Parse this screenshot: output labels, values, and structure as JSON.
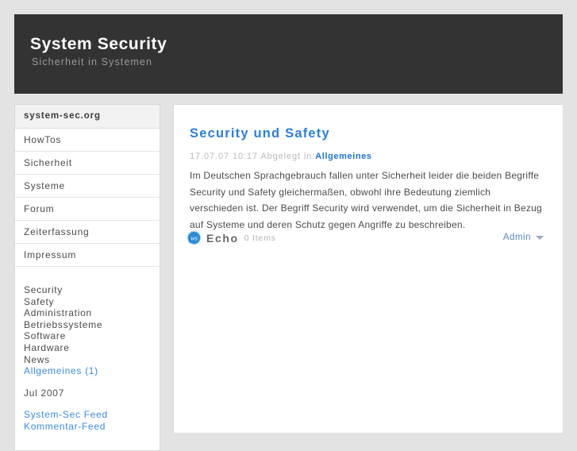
{
  "site": {
    "title": "System Security",
    "tagline": "Sicherheit in Systemen"
  },
  "sidebar": {
    "nav_header": "system-sec.org",
    "nav_items": [
      {
        "label": "HowTos"
      },
      {
        "label": "Sicherheit"
      },
      {
        "label": "Systeme"
      },
      {
        "label": "Forum"
      },
      {
        "label": "Zeiterfassung"
      },
      {
        "label": "Impressum"
      }
    ],
    "categories": [
      {
        "label": "Security",
        "active": false
      },
      {
        "label": "Safety",
        "active": false
      },
      {
        "label": "Administration",
        "active": false
      },
      {
        "label": "Betriebssysteme",
        "active": false
      },
      {
        "label": "Software",
        "active": false
      },
      {
        "label": "Hardware",
        "active": false
      },
      {
        "label": "News",
        "active": false
      },
      {
        "label": "Allgemeines (1)",
        "active": true
      }
    ],
    "archives": [
      {
        "label": "Jul 2007"
      }
    ],
    "feeds": [
      {
        "label": "System-Sec Feed"
      },
      {
        "label": "Kommentar-Feed"
      }
    ]
  },
  "post": {
    "title": "Security und Safety",
    "meta_date": "17.07.07 10:17 Abgelegt in:",
    "meta_category": "Allgemeines",
    "body": "Im Deutschen Sprachgebrauch fallen unter Sicherheit leider die beiden Begriffe Security und Safety gleichermaßen, obwohl ihre Bedeutung ziemlich verschieden ist. Der Begriff Security wird verwendet, um die Sicherheit in Bezug auf Systeme und deren Schutz gegen Angriffe zu beschreiben."
  },
  "echo": {
    "brand": "Echo",
    "items_count": "0 Items",
    "admin_label": "Admin",
    "icon": "echo-speech-bubble-icon",
    "caret_icon": "chevron-down-icon"
  },
  "colors": {
    "page_background": "#e3e3e3",
    "masthead": "#333333",
    "accent_blue": "#2a7fe0",
    "link_blue": "#3a8ae4",
    "meta_gray": "#b9b9b9",
    "body_text": "#4b4b4b"
  }
}
